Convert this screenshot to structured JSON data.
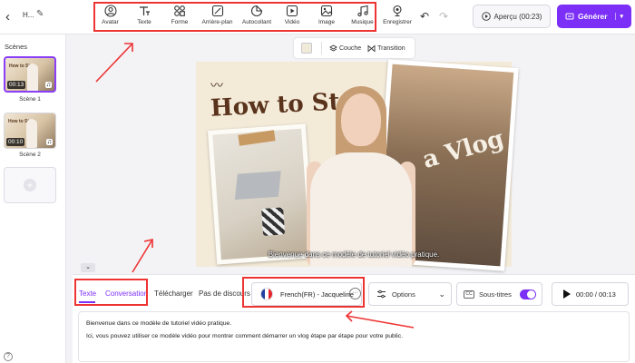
{
  "header": {
    "back_icon": "chevron-left-icon",
    "project_name": "H...",
    "tools": [
      {
        "label": "Avatar",
        "icon": "avatar-icon"
      },
      {
        "label": "Texte",
        "icon": "text-icon"
      },
      {
        "label": "Forme",
        "icon": "shape-icon"
      },
      {
        "label": "Arrière-plan",
        "icon": "background-icon"
      },
      {
        "label": "Autocollant",
        "icon": "sticker-icon"
      },
      {
        "label": "Vidéo",
        "icon": "video-icon"
      },
      {
        "label": "Image",
        "icon": "image-icon"
      },
      {
        "label": "Musique",
        "icon": "music-icon"
      }
    ],
    "record_label": "Enregistrer",
    "preview_label": "Aperçu (00:23)",
    "generate_label": "Générer"
  },
  "scenes": {
    "title": "Scènes",
    "items": [
      {
        "label": "Scène 1",
        "duration": "00:13",
        "thumb_title": "How to Start"
      },
      {
        "label": "Scène 2",
        "duration": "00:10",
        "thumb_title": "How to Start"
      }
    ]
  },
  "canvas_toolbar": {
    "layer_label": "Couche",
    "transition_label": "Transition"
  },
  "canvas": {
    "title": "How to Start",
    "vlog": "a Vlog",
    "caption": "Bienvenue dans ce modèle de tutoriel vidéo pratique."
  },
  "bottom": {
    "tabs": [
      "Texte",
      "Conversation",
      "Télécharger",
      "Pas de discours"
    ],
    "voice": "French(FR) - Jacqueline",
    "options_label": "Options",
    "subtitles_label": "Sous-titres",
    "cc_label": "CC",
    "time": "00:00 / 00:13",
    "script_lines": [
      "Bienvenue dans ce modèle de tutoriel vidéo pratique.",
      "Ici, vous pouvez utiliser ce modèle vidéo pour montrer comment démarrer un vlog étape par étape pour votre public."
    ]
  },
  "colors": {
    "accent": "#7b2ff7",
    "annotation": "#e33333"
  }
}
